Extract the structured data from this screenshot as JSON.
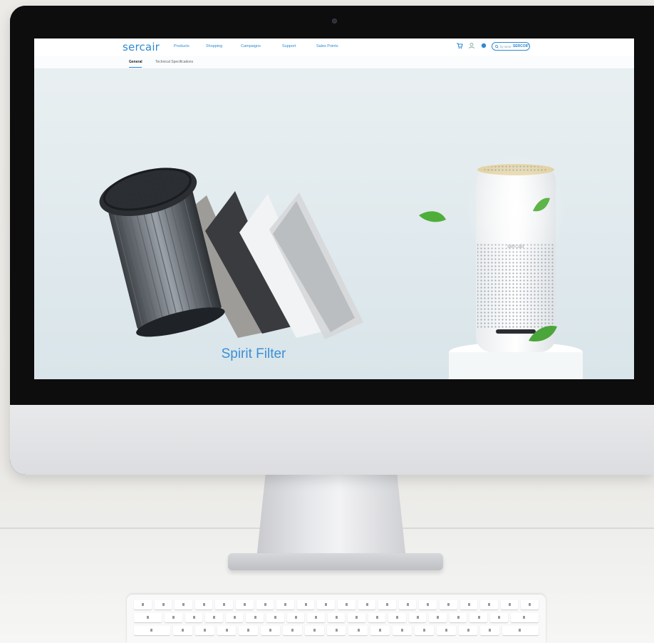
{
  "site": {
    "logo": "sercair",
    "nav": [
      "Products",
      "Shopping",
      "Campaigns",
      "Support",
      "Sales Points"
    ],
    "search": {
      "prefix": "by serer",
      "brand": "SERCOIF"
    },
    "subnav": {
      "general": "General",
      "specs": "Technical Specifications"
    },
    "hero_title": "Spirit Filter",
    "device_logo": "sercair"
  },
  "colors": {
    "accent": "#2f8ad2",
    "title": "#3c8fd6",
    "leaf": "#4fae3a"
  },
  "icons": [
    "cart-icon",
    "user-icon",
    "dot-icon",
    "search-icon"
  ]
}
